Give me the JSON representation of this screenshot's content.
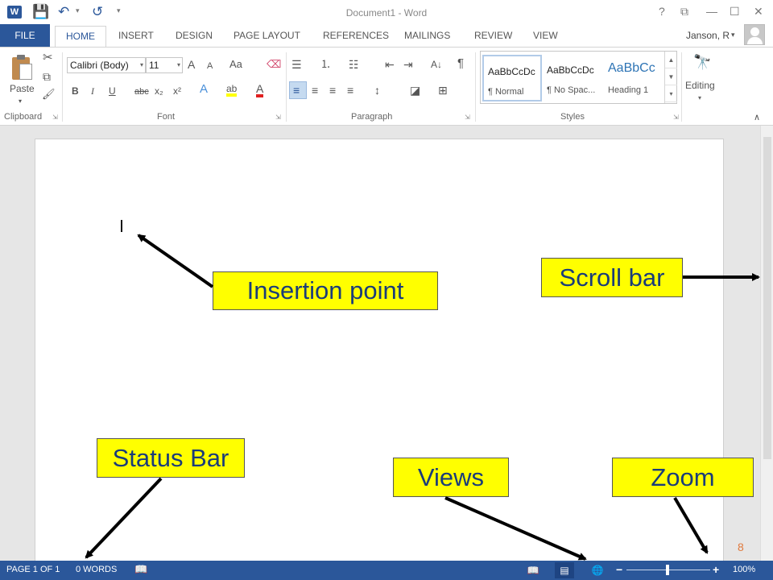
{
  "window": {
    "title": "Document1 - Word",
    "help": "?",
    "ribbon_display_options": "⧉",
    "minimize": "—",
    "maximize": "☐",
    "close": "✕"
  },
  "quick_access": {
    "app_icon": "W",
    "save_icon": "💾",
    "undo_icon": "↶",
    "undo_dropdown": "▾",
    "redo_icon": "↺",
    "customize_icon": "▾"
  },
  "tabs": {
    "file": "FILE",
    "home": "HOME",
    "others": [
      "INSERT",
      "DESIGN",
      "PAGE LAYOUT",
      "REFERENCES",
      "MAILINGS",
      "REVIEW",
      "VIEW"
    ]
  },
  "user": {
    "name": "Janson, R",
    "caret": "▾"
  },
  "ribbon": {
    "clipboard": {
      "paste_label": "Paste",
      "paste_caret": "▾",
      "cut_icon": "✂",
      "copy_icon": "⧉",
      "format_painter_icon": "🖌",
      "group_label": "Clipboard",
      "launcher": "⇲"
    },
    "font": {
      "font_name": "Calibri (Body)",
      "font_size": "11",
      "dd": "▾",
      "grow": "A",
      "shrink": "A",
      "change_case": "Aa",
      "clear_formatting": "⌫",
      "bold": "B",
      "italic": "I",
      "underline": "U",
      "strikethrough": "abc",
      "subscript": "x₂",
      "superscript": "x²",
      "text_effects": "A",
      "highlight": "ab",
      "font_color": "A",
      "group_label": "Font",
      "launcher": "⇲"
    },
    "paragraph": {
      "bullets": "☰",
      "numbering": "⒈",
      "multilevel": "☷",
      "decrease_indent": "⇤",
      "increase_indent": "⇥",
      "sort": "A↓",
      "show_marks": "¶",
      "align_left": "≡",
      "align_center": "≡",
      "align_right": "≡",
      "justify": "≡",
      "line_spacing": "↕",
      "shading": "◪",
      "borders": "⊞",
      "group_label": "Paragraph",
      "launcher": "⇲"
    },
    "styles": {
      "tiles": [
        {
          "sample": "AaBbCcDc",
          "name": "¶ Normal"
        },
        {
          "sample": "AaBbCcDc",
          "name": "¶ No Spac..."
        },
        {
          "sample": "AaBbCc",
          "name": "Heading 1"
        }
      ],
      "scroll_up": "▲",
      "scroll_down": "▼",
      "more": "▾",
      "group_label": "Styles",
      "launcher": "⇲"
    },
    "editing": {
      "icon": "🔭",
      "label": "Editing",
      "caret": "▾"
    },
    "collapse": "∧"
  },
  "callouts": {
    "insertion_point": "Insertion point",
    "scroll_bar": "Scroll bar",
    "status_bar": "Status Bar",
    "views": "Views",
    "zoom": "Zoom"
  },
  "slide_number": "8",
  "status": {
    "page": "PAGE 1 OF 1",
    "words": "0 WORDS",
    "proofing_icon": "📖",
    "view_read": "📖",
    "view_print": "▤",
    "view_web": "🌐",
    "zoom_minus": "−",
    "zoom_plus": "+",
    "zoom_level": "100%"
  },
  "colors": {
    "word_blue": "#2b579a",
    "callout_yellow": "#ffff00",
    "callout_text": "#1a3c7a"
  }
}
